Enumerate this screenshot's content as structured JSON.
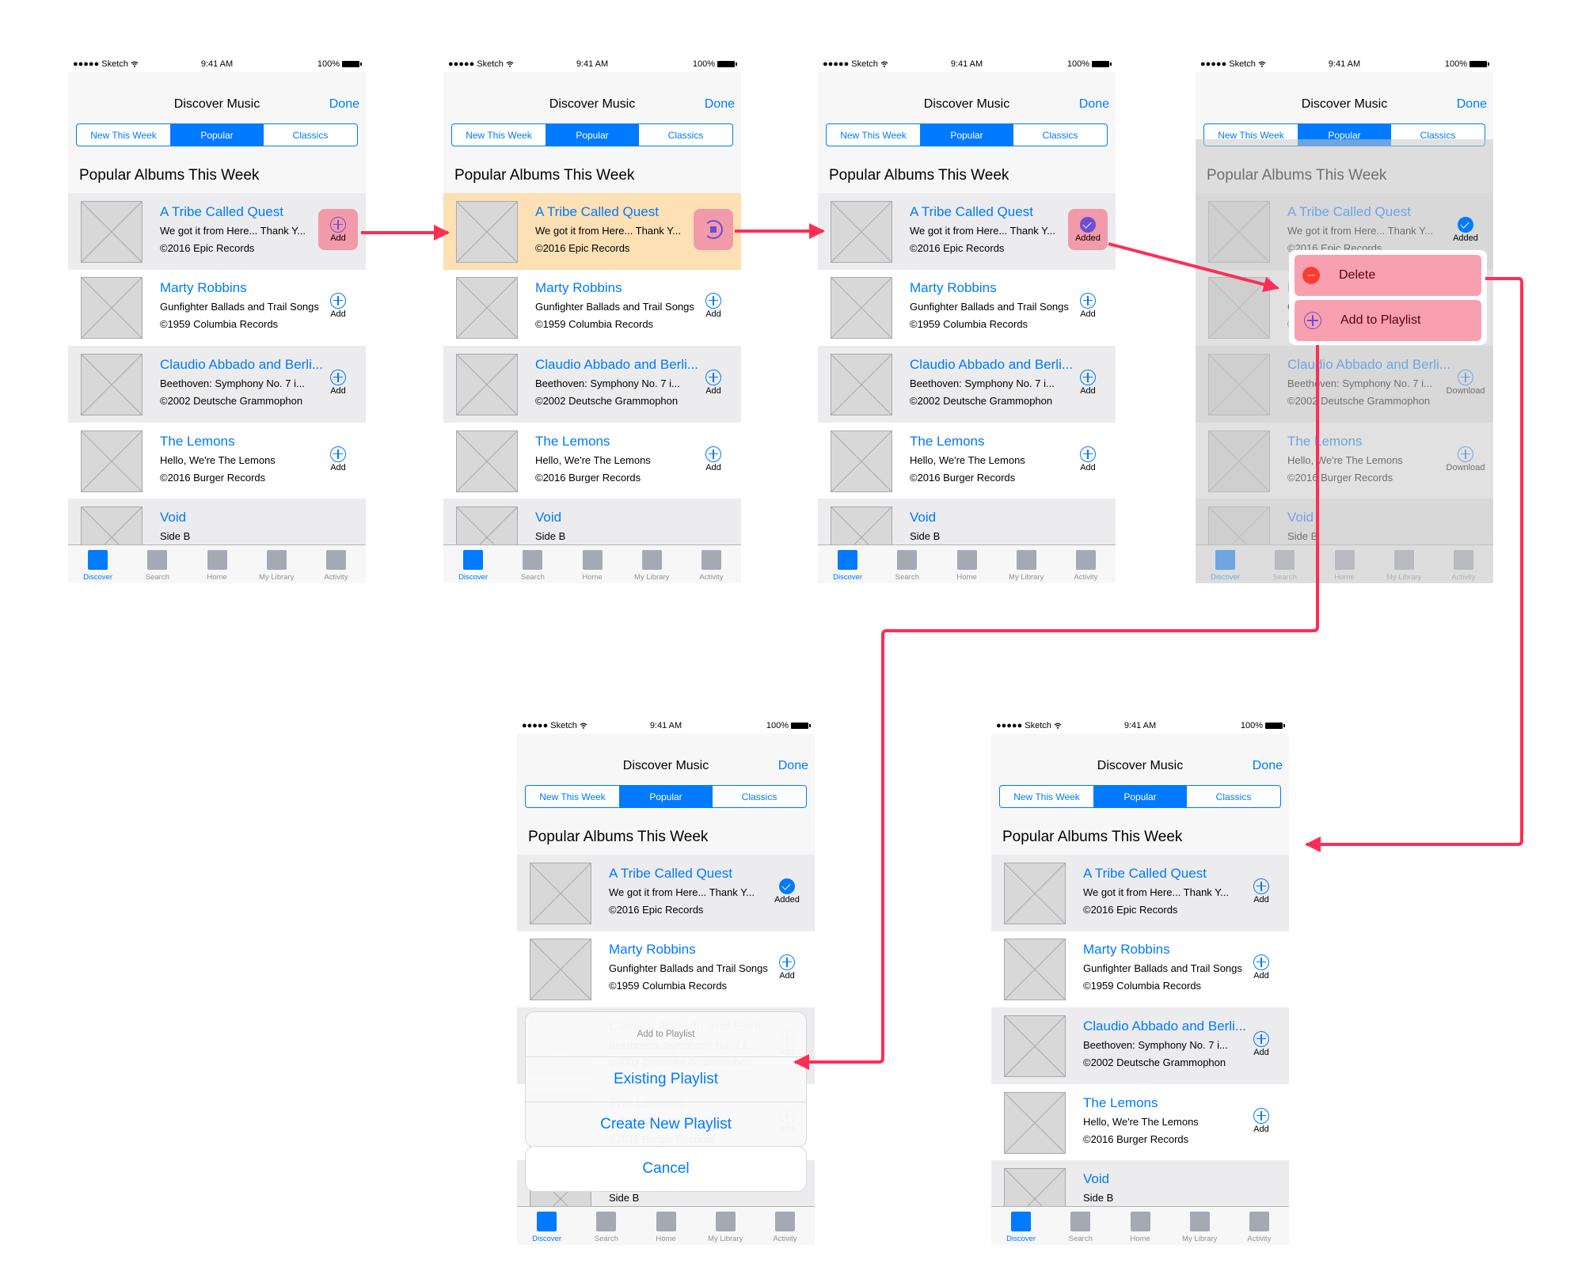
{
  "status": {
    "carrier": "●●●●● Sketch",
    "wifi_icon": "wifi-icon",
    "time": "9:41 AM",
    "battery": "100%"
  },
  "nav": {
    "title": "Discover Music",
    "done": "Done"
  },
  "segments": [
    "New This Week",
    "Popular",
    "Classics"
  ],
  "active_segment": "Popular",
  "section_title": "Popular Albums This Week",
  "albums": [
    {
      "artist": "A Tribe Called Quest",
      "album": "We got it from Here... Thank Y...",
      "label": "©2016 Epic Records"
    },
    {
      "artist": "Marty Robbins",
      "album": "Gunfighter Ballads and Trail Songs",
      "label": "©1959 Columbia Records"
    },
    {
      "artist": "Claudio Abbado and Berli...",
      "album": "Beethoven: Symphony No. 7 i...",
      "label": "©2002 Deutsche Grammophon"
    },
    {
      "artist": "The Lemons",
      "album": "Hello, We're The Lemons",
      "label": "©2016 Burger Records"
    },
    {
      "artist": "Void",
      "album": "Side B",
      "label": ""
    }
  ],
  "action_labels": {
    "add": "Add",
    "added": "Added",
    "download": "Download"
  },
  "tabs": [
    "Discover",
    "Search",
    "Home",
    "My Library",
    "Activity"
  ],
  "active_tab": "Discover",
  "frames": [
    {
      "id": "step-1",
      "tribe_state": "add-highlighted"
    },
    {
      "id": "step-2",
      "tribe_state": "downloading"
    },
    {
      "id": "step-3",
      "tribe_state": "added-highlighted"
    },
    {
      "id": "step-4",
      "tribe_state": "added-context-menu"
    },
    {
      "id": "step-5",
      "tribe_state": "added-action-sheet"
    },
    {
      "id": "step-6",
      "tribe_state": "add"
    }
  ],
  "context_menu": {
    "delete": "Delete",
    "add_to_playlist": "Add to Playlist"
  },
  "action_sheet": {
    "title": "Add to Playlist",
    "existing": "Existing Playlist",
    "create": "Create New Playlist",
    "cancel": "Cancel"
  },
  "colors": {
    "accent": "#007aff",
    "flow_arrow": "#ff2d55",
    "highlight_pink": "#f39aaa",
    "row_highlight": "#fde0b3",
    "progress_purple": "#6a4fd0",
    "delete_red": "#ff3b30"
  }
}
